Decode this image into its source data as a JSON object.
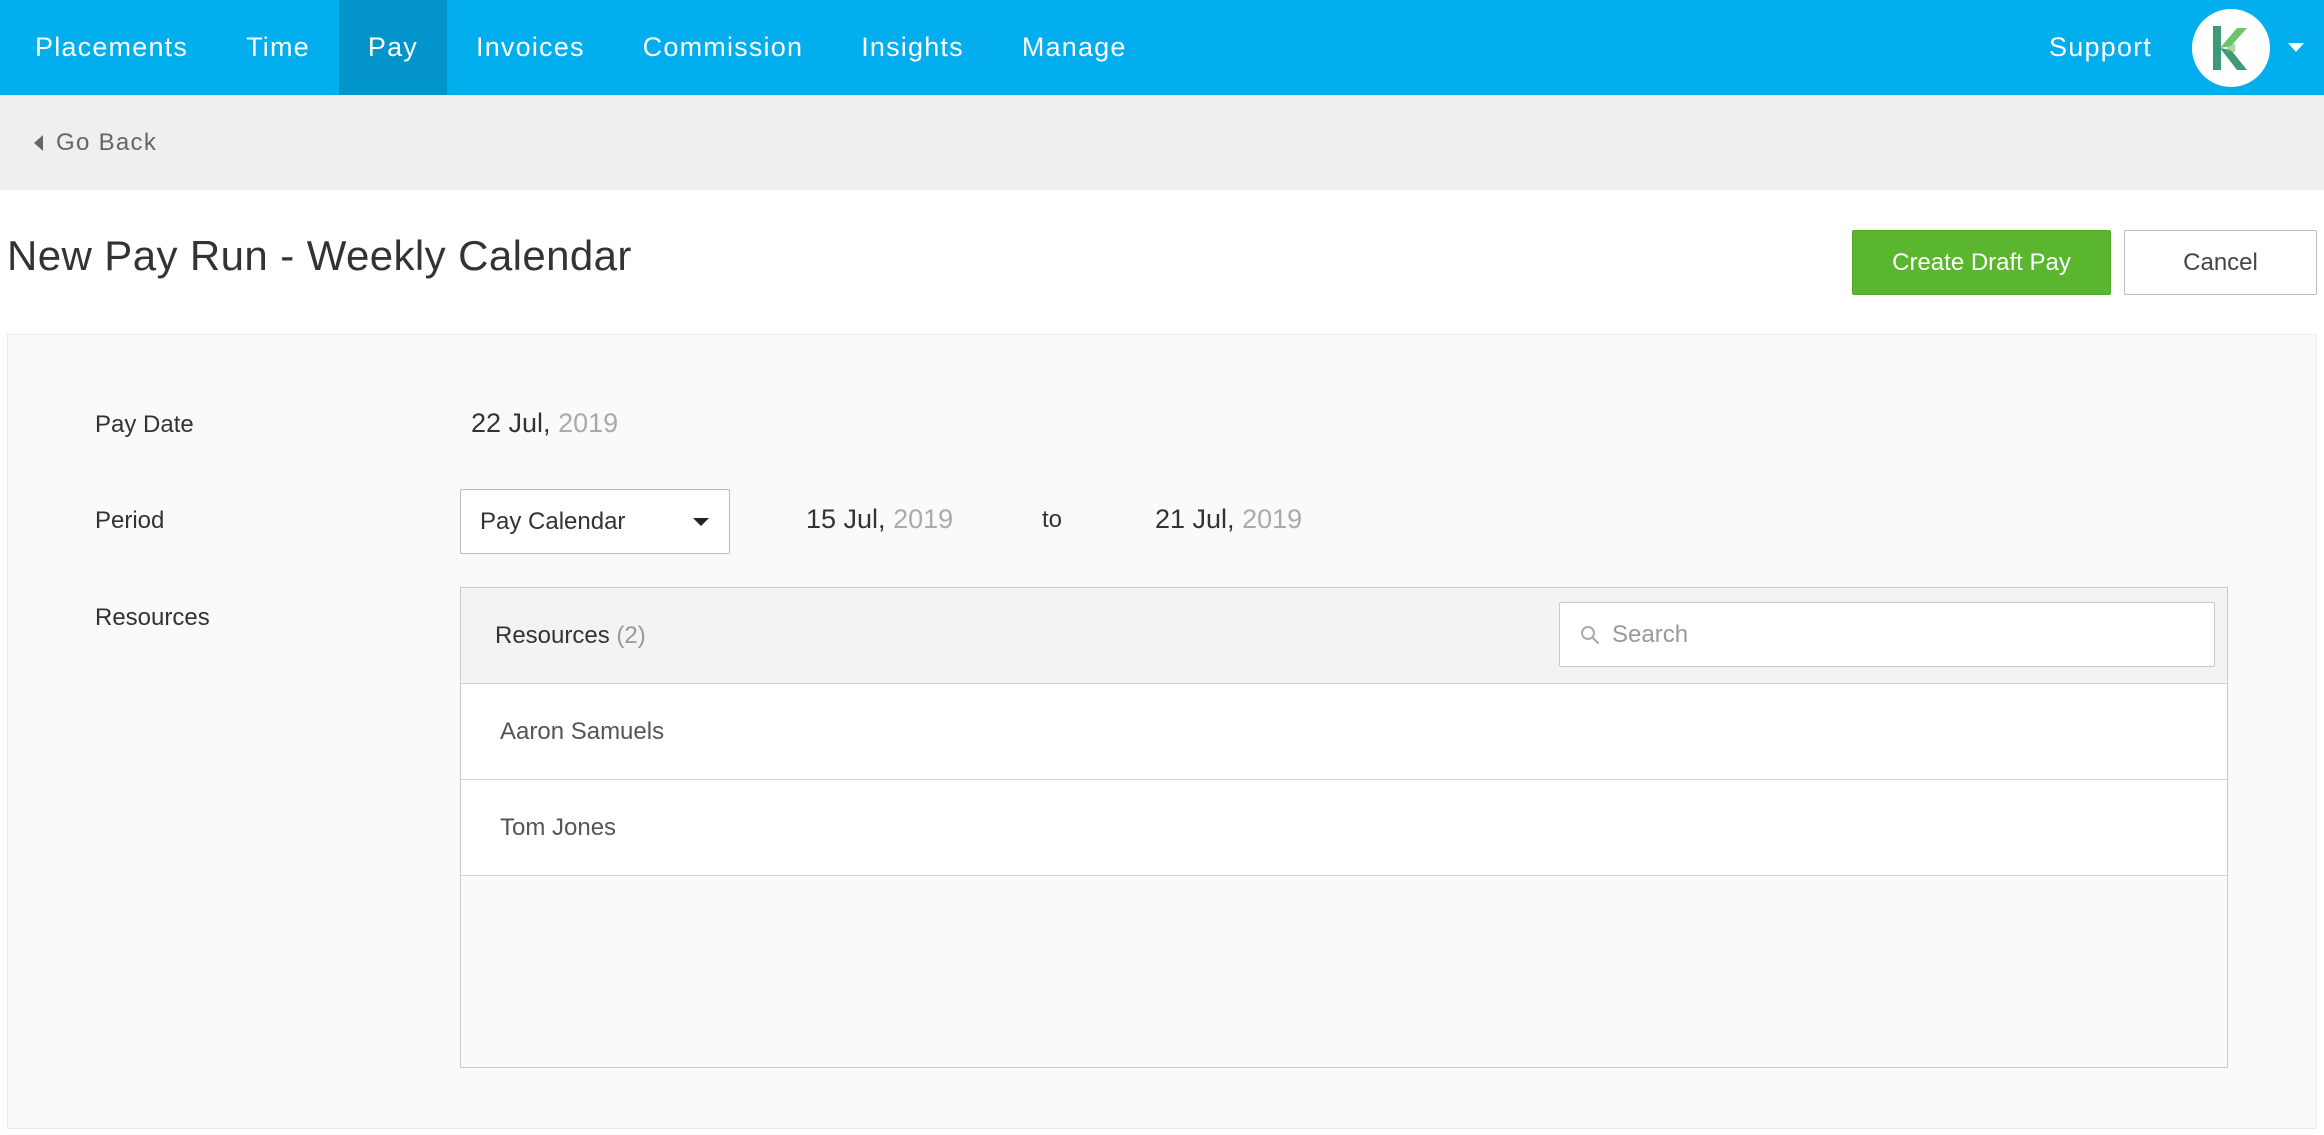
{
  "nav": {
    "items": [
      {
        "label": "Placements"
      },
      {
        "label": "Time"
      },
      {
        "label": "Pay",
        "active": true
      },
      {
        "label": "Invoices"
      },
      {
        "label": "Commission"
      },
      {
        "label": "Insights"
      },
      {
        "label": "Manage"
      }
    ],
    "support_label": "Support",
    "avatar_letter": "K",
    "avatar_icon": "logo-k-icon",
    "brand_color": "#03aeef",
    "active_color": "#0294cb"
  },
  "subbar": {
    "back_label": "Go Back",
    "back_icon": "caret-left-icon"
  },
  "header": {
    "title": "New Pay Run - Weekly Calendar",
    "create_label": "Create Draft Pay",
    "cancel_label": "Cancel",
    "create_color": "#5ab52f"
  },
  "form": {
    "pay_date_label": "Pay Date",
    "pay_date": {
      "day_month": "22 Jul,",
      "year": " 2019"
    },
    "period_label": "Period",
    "period_select_value": "Pay Calendar",
    "period_start": {
      "day_month": "15 Jul,",
      "year": " 2019"
    },
    "period_to": "to",
    "period_end": {
      "day_month": "21 Jul,",
      "year": " 2019"
    },
    "resources_label": "Resources"
  },
  "resources": {
    "title": "Resources",
    "count": "(2)",
    "search_placeholder": "Search",
    "search_icon": "search-icon",
    "items": [
      {
        "name": "Aaron Samuels"
      },
      {
        "name": "Tom Jones"
      }
    ]
  }
}
